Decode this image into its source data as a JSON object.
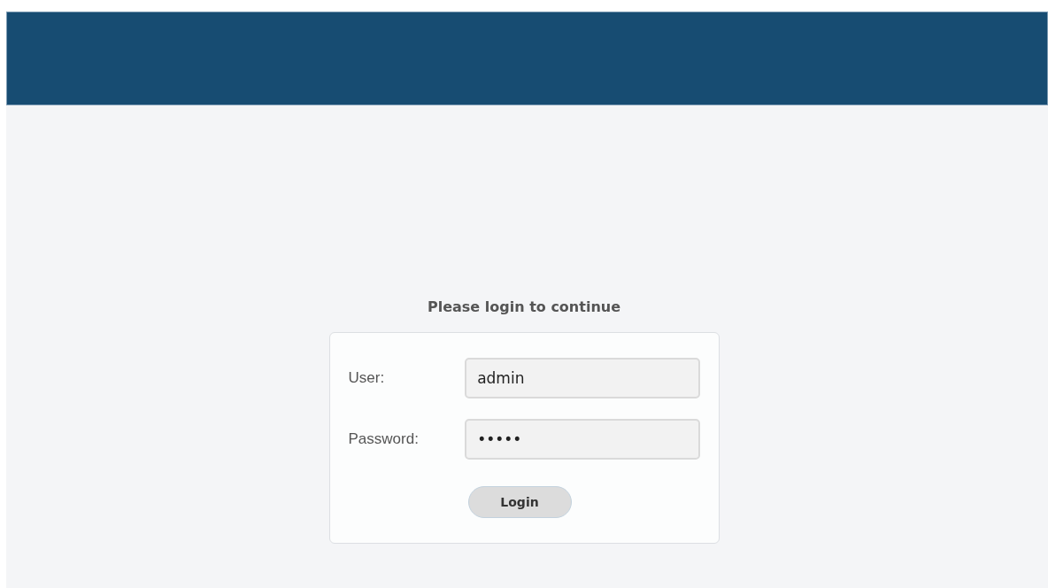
{
  "title": "Please login to continue",
  "fields": [
    {
      "label": "User:",
      "value": "admin"
    },
    {
      "label": "Password:",
      "value": "•••••"
    }
  ],
  "button": "Login"
}
